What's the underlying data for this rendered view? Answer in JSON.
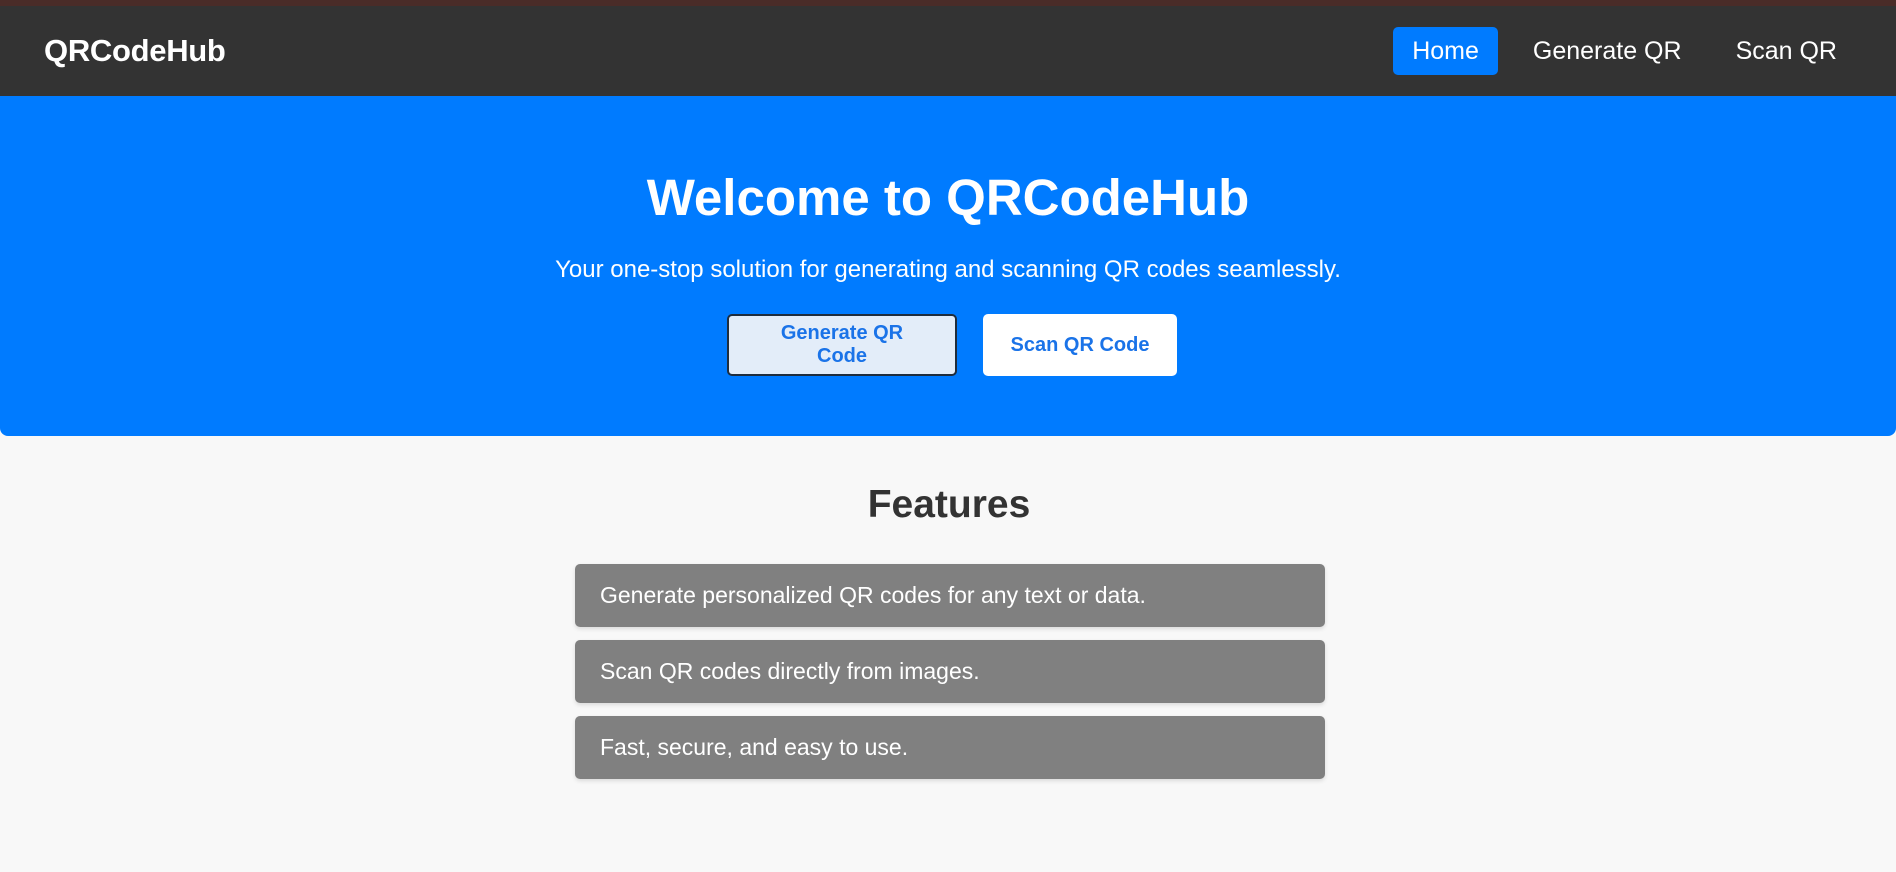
{
  "navbar": {
    "brand": "QRCodeHub",
    "links": [
      {
        "label": "Home",
        "active": true
      },
      {
        "label": "Generate QR",
        "active": false
      },
      {
        "label": "Scan QR",
        "active": false
      }
    ]
  },
  "hero": {
    "title": "Welcome to QRCodeHub",
    "subtitle": "Your one-stop solution for generating and scanning QR codes seamlessly.",
    "primary_button": "Generate QR Code",
    "secondary_button": "Scan QR Code"
  },
  "features": {
    "title": "Features",
    "items": [
      "Generate personalized QR codes for any text or data.",
      "Scan QR codes directly from images.",
      "Fast, secure, and easy to use."
    ]
  },
  "colors": {
    "navbar_bg": "#333333",
    "accent": "#007bff",
    "feature_bg": "#808080",
    "page_bg": "#f8f8f8"
  }
}
